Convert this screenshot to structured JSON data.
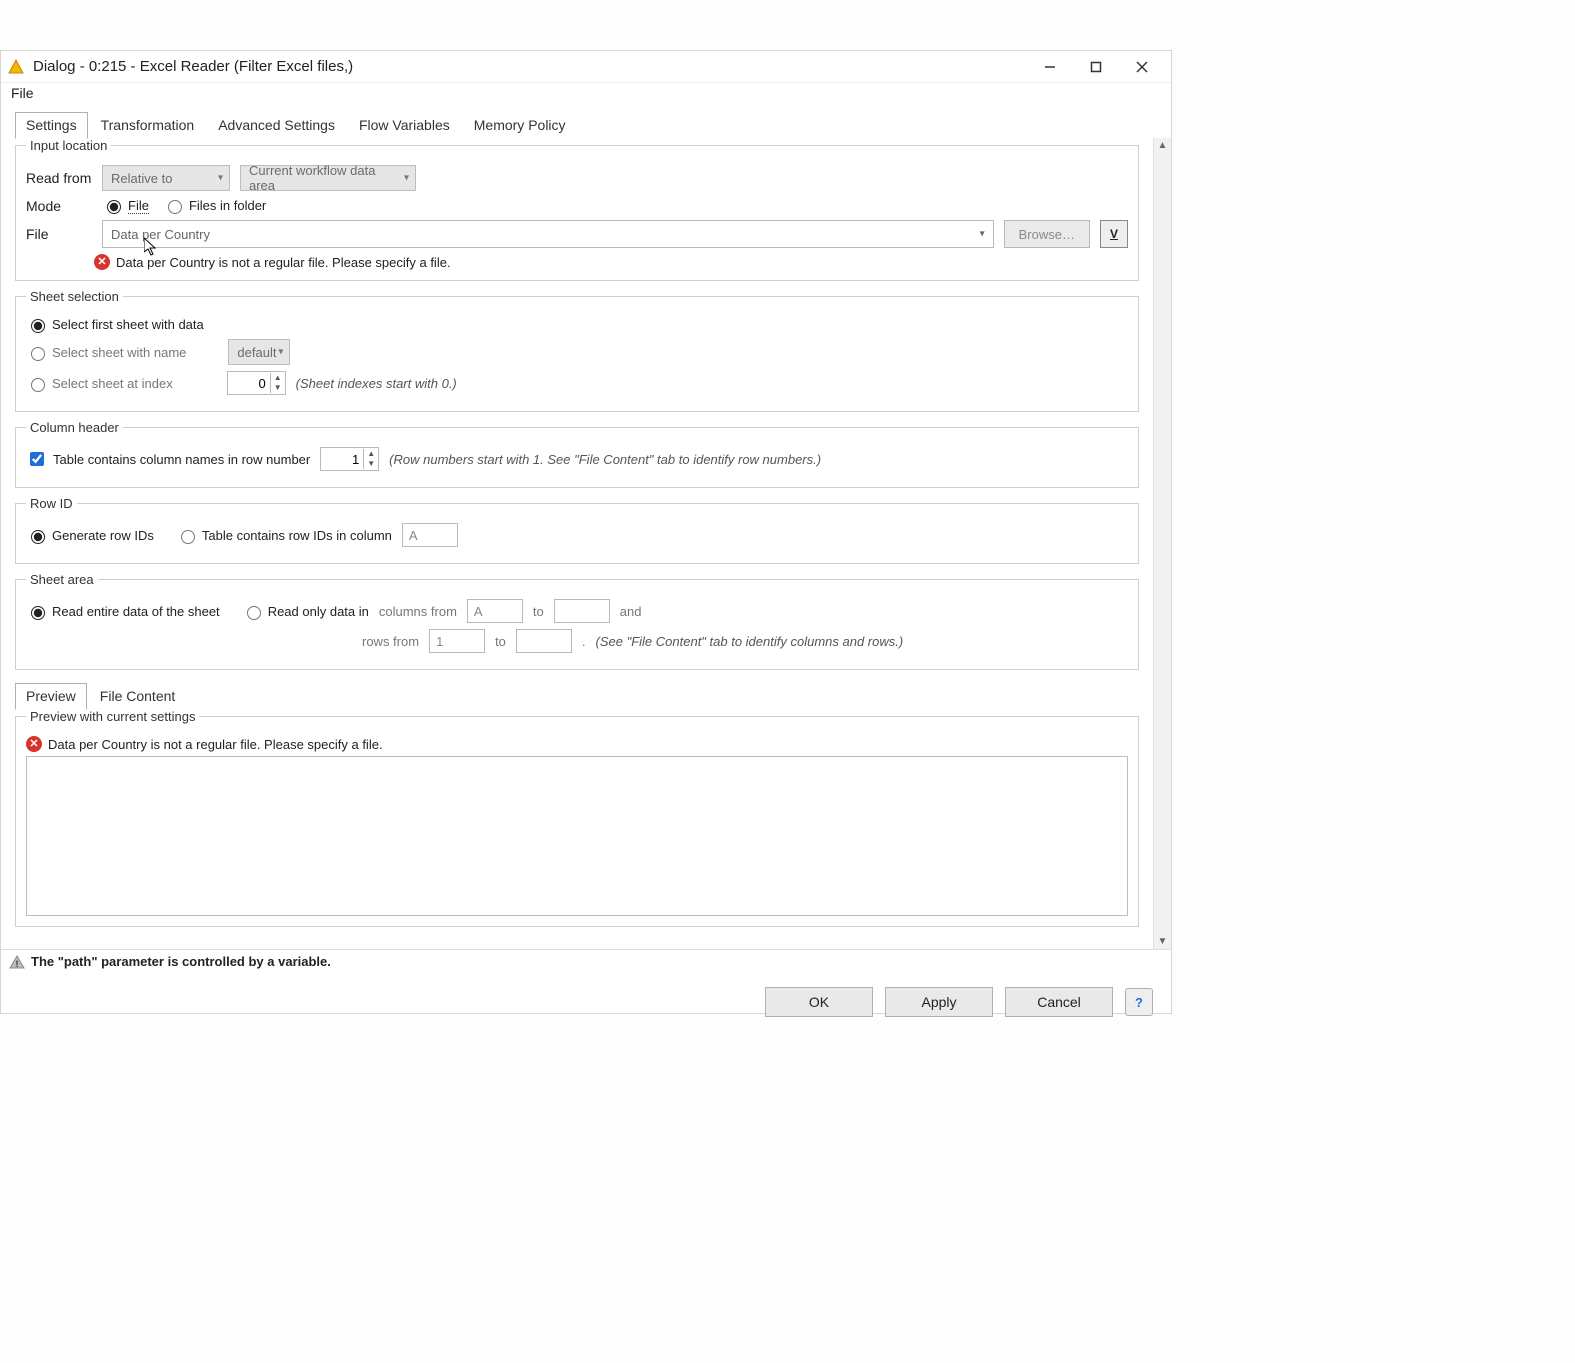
{
  "window": {
    "title": "Dialog - 0:215 - Excel Reader (Filter Excel files,)"
  },
  "menubar": {
    "file": "File"
  },
  "tabs": {
    "settings": "Settings",
    "transformation": "Transformation",
    "advanced": "Advanced Settings",
    "flowvars": "Flow Variables",
    "memory": "Memory Policy"
  },
  "input_location": {
    "legend": "Input location",
    "read_from_label": "Read from",
    "read_from_value": "Relative to",
    "read_from_scope": "Current workflow data area",
    "mode_label": "Mode",
    "mode_file": "File",
    "mode_folder": "Files in folder",
    "file_label": "File",
    "file_value": "Data per Country",
    "browse": "Browse…",
    "error": "Data per Country is not a regular file. Please specify a file."
  },
  "sheet_selection": {
    "legend": "Sheet selection",
    "first": "Select first sheet with data",
    "by_name": "Select sheet with name",
    "sheet_name": "default",
    "by_index": "Select sheet at index",
    "index_value": "0",
    "index_hint": "(Sheet indexes start with 0.)"
  },
  "column_header": {
    "legend": "Column header",
    "checkbox": "Table contains column names in row number",
    "row_value": "1",
    "hint": "(Row numbers start with 1. See \"File Content\" tab to identify row numbers.)"
  },
  "row_id": {
    "legend": "Row ID",
    "generate": "Generate row IDs",
    "in_column": "Table contains row IDs in column",
    "col_value": "A"
  },
  "sheet_area": {
    "legend": "Sheet area",
    "entire": "Read entire data of the sheet",
    "only": "Read only data in",
    "cols_from": "columns from",
    "col_a": "A",
    "to": "to",
    "and": "and",
    "rows_from": "rows from",
    "row_1": "1",
    "dot": ".",
    "hint": "(See \"File Content\" tab to identify columns and rows.)"
  },
  "preview_tabs": {
    "preview": "Preview",
    "filecontent": "File Content"
  },
  "preview": {
    "legend": "Preview with current settings",
    "error": "Data per Country is not a regular file. Please specify a file."
  },
  "status": "The \"path\" parameter is controlled by a variable.",
  "footer": {
    "ok": "OK",
    "apply": "Apply",
    "cancel": "Cancel"
  }
}
